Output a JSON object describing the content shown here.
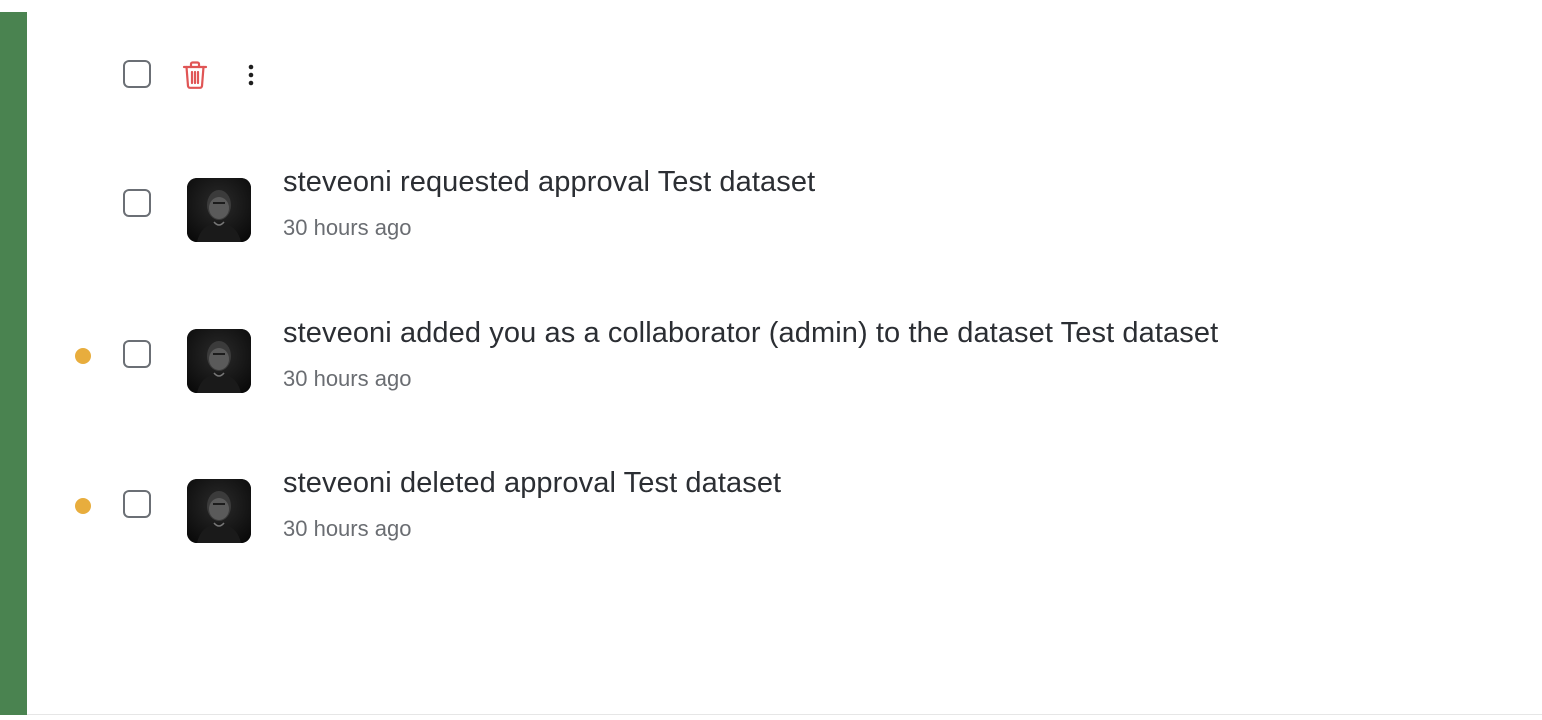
{
  "toolbar": {
    "select_all_icon": "checkbox-empty",
    "delete_icon": "trash-icon",
    "more_icon": "kebab-menu-icon",
    "delete_color": "#e05555"
  },
  "notifications": [
    {
      "unread": false,
      "avatar": "user-avatar-photo",
      "text": "steveoni requested approval Test dataset",
      "time": "30 hours ago"
    },
    {
      "unread": true,
      "avatar": "user-avatar-photo",
      "text": "steveoni added you as a collaborator (admin) to the dataset Test dataset",
      "time": "30 hours ago"
    },
    {
      "unread": true,
      "avatar": "user-avatar-photo",
      "text": "steveoni deleted approval Test dataset",
      "time": "30 hours ago"
    }
  ],
  "colors": {
    "sidebar_accent": "#4a8350",
    "unread_dot": "#e8ad3d",
    "text_primary": "#2b2e33",
    "text_secondary": "#6a6d72"
  }
}
